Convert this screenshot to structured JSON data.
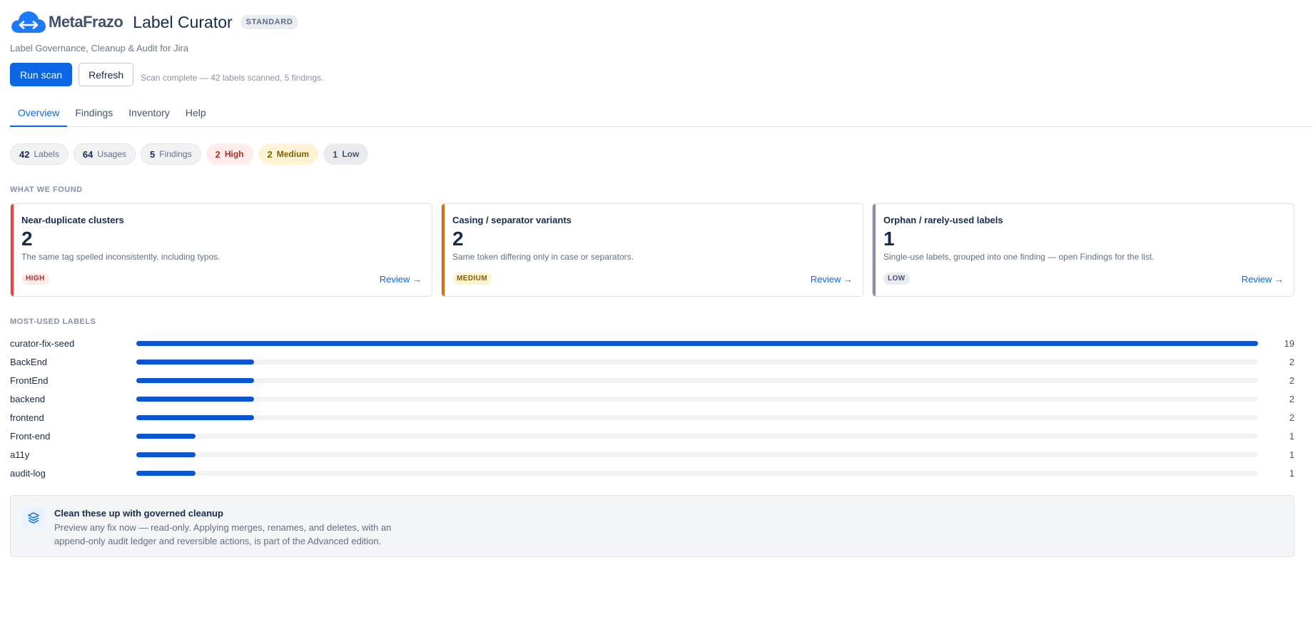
{
  "brand": {
    "name": "MetaFrazo",
    "icon": "cloud-arrows-icon"
  },
  "app": {
    "title": "Label Curator",
    "edition": "STANDARD",
    "subtitle": "Label Governance, Cleanup & Audit for Jira"
  },
  "actions": {
    "run_scan": "Run scan",
    "refresh": "Refresh",
    "status": "Scan complete — 42 labels scanned, 5 findings."
  },
  "tabs": [
    {
      "label": "Overview",
      "active": true
    },
    {
      "label": "Findings",
      "active": false
    },
    {
      "label": "Inventory",
      "active": false
    },
    {
      "label": "Help",
      "active": false
    }
  ],
  "stats": [
    {
      "value": "42",
      "label": "Labels",
      "kind": "neutral"
    },
    {
      "value": "64",
      "label": "Usages",
      "kind": "neutral"
    },
    {
      "value": "5",
      "label": "Findings",
      "kind": "neutral"
    },
    {
      "value": "2",
      "label": "High",
      "kind": "high"
    },
    {
      "value": "2",
      "label": "Medium",
      "kind": "medium"
    },
    {
      "value": "1",
      "label": "Low",
      "kind": "low"
    }
  ],
  "sections": {
    "found": "WHAT WE FOUND",
    "most_used": "MOST-USED LABELS"
  },
  "findings": [
    {
      "title": "Near-duplicate clusters",
      "count": "2",
      "description": "The same tag spelled inconsistently, including typos.",
      "severity": "HIGH",
      "action": "Review →",
      "accent": "#e2483d"
    },
    {
      "title": "Casing / separator variants",
      "count": "2",
      "description": "Same token differing only in case or separators.",
      "severity": "MEDIUM",
      "action": "Review →",
      "accent": "#d97008"
    },
    {
      "title": "Orphan / rarely-used labels",
      "count": "1",
      "description": "Single-use labels, grouped into one finding — open Findings for the list.",
      "severity": "LOW",
      "action": "Review →",
      "accent": "#8590a2"
    }
  ],
  "label_usage": [
    {
      "label": "curator-fix-seed",
      "count": 19
    },
    {
      "label": "BackEnd",
      "count": 2
    },
    {
      "label": "FrontEnd",
      "count": 2
    },
    {
      "label": "backend",
      "count": 2
    },
    {
      "label": "frontend",
      "count": 2
    },
    {
      "label": "Front-end",
      "count": 1
    },
    {
      "label": "a11y",
      "count": 1
    },
    {
      "label": "audit-log",
      "count": 1
    }
  ],
  "banner": {
    "icon": "layers-icon",
    "title": "Clean these up with governed cleanup",
    "text": "Preview any fix now — read-only. Applying merges, renames, and deletes, with an append-only audit ledger and reversible actions, is part of the Advanced edition."
  },
  "colors": {
    "primary": "#0c66e4",
    "bar": "#0c55d0",
    "high": "#ae2e24",
    "medium": "#7f5f01",
    "low": "#44546f"
  }
}
